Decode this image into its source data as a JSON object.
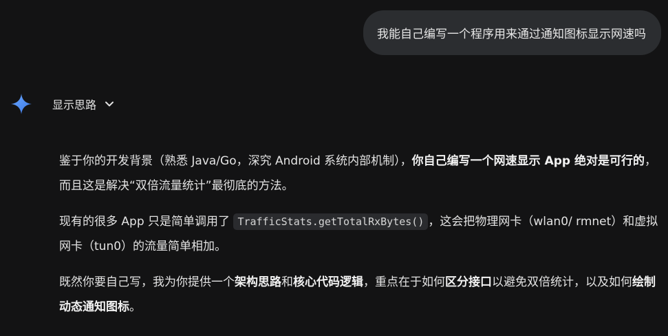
{
  "user_message": "我能自己编写一个程序用来通过通知图标显示网速吗",
  "thoughts": {
    "label": "显示思路",
    "toggle_icon": "chevron-down-icon"
  },
  "assistant_icon": "gemini-spark-icon",
  "colors": {
    "background": "#131314",
    "bubble": "#2b2d30",
    "spark_blue": "#4a8ef0"
  },
  "answer": {
    "p1": {
      "t1": "鉴于你的开发背景（熟悉 Java/Go，深究 Android 系统内部机制），",
      "b1": "你自己编写一个网速显示 App 绝对是可行的",
      "t2": "，而且这是解决“双倍流量统计”最彻底的方法。"
    },
    "p2": {
      "t1": "现有的很多 App 只是简单调用了 ",
      "code": "TrafficStats.getTotalRxBytes()",
      "t2": "，这会把物理网卡（wlan0/ rmnet）和虚拟网卡（tun0）的流量简单相加。"
    },
    "p3": {
      "t1": "既然你要自己写，我为你提供一个",
      "b1": "架构思路",
      "t2": "和",
      "b2": "核心代码逻辑",
      "t3": "，重点在于如何",
      "b3": "区分接口",
      "t4": "以避免双倍统计，以及如何",
      "b4": "绘制动态通知图标",
      "t5": "。"
    }
  }
}
